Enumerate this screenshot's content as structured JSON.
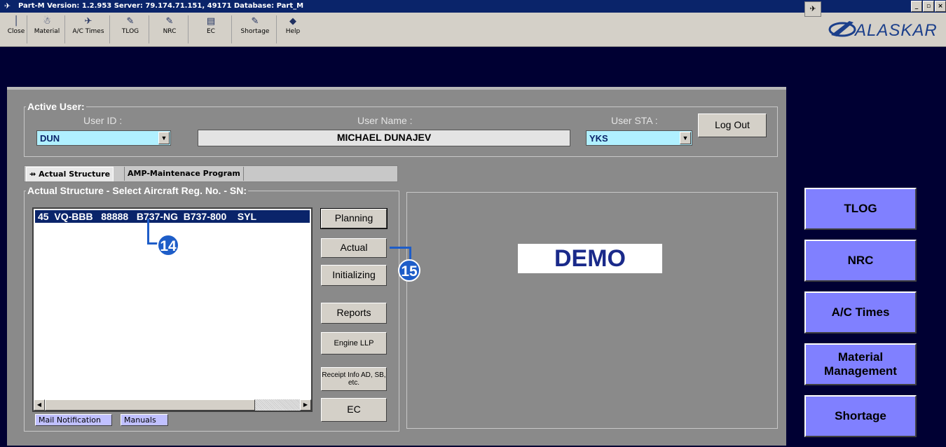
{
  "window": {
    "title": "Part-M Version: 1.2.953    Server: 79.174.71.151, 49171 Database: Part_M",
    "minimize": "_",
    "restore": "2"
  },
  "toolbar": {
    "buttons": [
      {
        "label": "Close",
        "icon": "door-exit-icon",
        "glyph": "│"
      },
      {
        "label": "Material",
        "icon": "material-icon",
        "glyph": "☃"
      },
      {
        "label": "A/C Times",
        "icon": "aircraft-icon",
        "glyph": "✈"
      },
      {
        "label": "TLOG",
        "icon": "tlog-icon",
        "glyph": "✎"
      },
      {
        "label": "NRC",
        "icon": "nrc-icon",
        "glyph": "✎"
      },
      {
        "label": "EC",
        "icon": "ec-icon",
        "glyph": "▤"
      },
      {
        "label": "Shortage",
        "icon": "shortage-icon",
        "glyph": "✎"
      },
      {
        "label": "Help",
        "icon": "help-icon",
        "glyph": "◆"
      }
    ]
  },
  "logo": {
    "text": "ALASKAR"
  },
  "active_user": {
    "legend": "Active User:",
    "user_id_label": "User ID :",
    "user_id": "DUN",
    "user_name_label": "User Name :",
    "user_name": "MICHAEL DUNAJEV",
    "user_sta_label": "User STA :",
    "user_sta": "YKS",
    "logout": "Log Out"
  },
  "tabs": [
    {
      "label": "Actual Structure",
      "active": true
    },
    {
      "label": "AMP-Maintenace Program",
      "active": false
    }
  ],
  "structure": {
    "legend": "Actual Structure - Select Aircraft Reg. No. - SN:",
    "rows": [
      "45  VQ-BBB   88888   B737-NG  B737-800    SYL"
    ]
  },
  "actions": {
    "planning": "Planning",
    "actual": "Actual",
    "initializing": "Initializing",
    "reports": "Reports",
    "engine_llp": "Engine LLP",
    "receipt_info": "Receipt Info AD, SB, etc.",
    "ec": "EC"
  },
  "bottom": {
    "mail": "Mail Notification",
    "manuals": "Manuals"
  },
  "demo": "DEMO",
  "side": {
    "tlog": "TLOG",
    "nrc": "NRC",
    "ac_times": "A/C Times",
    "material": "Material Management",
    "shortage": "Shortage"
  },
  "callouts": {
    "c14": "14",
    "c15": "15"
  },
  "colors": {
    "accent": "#0a246a",
    "side_button": "#8080ff",
    "callout": "#1e5dc8",
    "combo_bg": "#b0f0ff"
  }
}
